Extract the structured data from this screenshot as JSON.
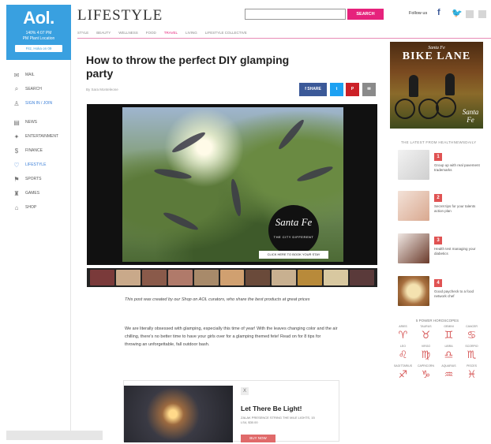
{
  "sidebar": {
    "logo": "Aol.",
    "logo_sub": "140% 4:07 PM\nPM Plant Location",
    "logo_button": "Fitz, Hoka on 09",
    "items": [
      {
        "icon": "✉",
        "label": "MAIL"
      },
      {
        "icon": "⌕",
        "label": "SEARCH"
      },
      {
        "icon": "♙",
        "label": "SIGN IN / JOIN"
      },
      {
        "icon": "▤",
        "label": "NEWS"
      },
      {
        "icon": "✦",
        "label": "ENTERTAINMENT"
      },
      {
        "icon": "$",
        "label": "FINANCE"
      },
      {
        "icon": "♡",
        "label": "LIFESTYLE"
      },
      {
        "icon": "⚑",
        "label": "SPORTS"
      },
      {
        "icon": "♜",
        "label": "GAMES"
      },
      {
        "icon": "⌂",
        "label": "SHOP"
      }
    ]
  },
  "header": {
    "brand": "LIFESTYLE",
    "search_placeholder": "",
    "search_button": "SEARCH",
    "follow_label": "Follow us",
    "social_f": "f",
    "social_t": "🐦",
    "subnav": [
      "STYLE",
      "BEAUTY",
      "WELLNESS",
      "FOOD",
      "TRAVEL",
      "LIVING",
      "LIFESTYLE COLLECTIVE"
    ],
    "active_subnav": "TRAVEL"
  },
  "article": {
    "title": "How to throw the perfect DIY glamping party",
    "byline": "By Sara Monteleone",
    "share_fb": "f SHARE",
    "share_tw": "t",
    "share_pi": "P",
    "share_em": "✉",
    "video_logo_script": "Santa Fe",
    "video_logo_tag": "THE CITY DIFFERENT",
    "video_cta": "CLICK HERE TO BOOK YOUR STAY",
    "caption": "This post was created by our Shop on AOL curators, who share the best products at great prices",
    "body": "We are literally obsessed with glamping, especially this time of year! With the leaves changing color and the air chilling, there's no better time to have your girls over for a glamping themed fete! Read on for 8 tips for throwing an unforgettable, fall outdoor bash."
  },
  "card": {
    "close": "X",
    "title": "Let There Be Light!",
    "subtitle": "ZALAK PRESENCE STRING THE MILE LIGHTS, 15 LS4, $30.00",
    "button": "BUY NOW"
  },
  "ad": {
    "sub": "Santa Fe",
    "title": "BIKE LANE",
    "sign": "Santa Fe"
  },
  "rail": {
    "heading": "THE LATEST FROM HEALTHNEWSDAILY",
    "items": [
      {
        "num": "1",
        "text": "Group up with real pavement trademarks"
      },
      {
        "num": "2",
        "text": "Secret tips for your talents action plan"
      },
      {
        "num": "3",
        "text": "Health test managing your diabetics"
      },
      {
        "num": "4",
        "text": "Good paycheck to a food network chef"
      }
    ]
  },
  "horoscope": {
    "heading": "5 POWER HOROSCOPES",
    "signs": [
      {
        "name": "ARIES",
        "symbol": "♈"
      },
      {
        "name": "TAURUS",
        "symbol": "♉"
      },
      {
        "name": "GEMINI",
        "symbol": "♊"
      },
      {
        "name": "CANCER",
        "symbol": "♋"
      },
      {
        "name": "LEO",
        "symbol": "♌"
      },
      {
        "name": "VIRGO",
        "symbol": "♍"
      },
      {
        "name": "LIBRA",
        "symbol": "♎"
      },
      {
        "name": "SCORPIO",
        "symbol": "♏"
      },
      {
        "name": "SAGITTARIUS",
        "symbol": "♐"
      },
      {
        "name": "CAPRICORN",
        "symbol": "♑"
      },
      {
        "name": "AQUARIUS",
        "symbol": "♒"
      },
      {
        "name": "PISCES",
        "symbol": "♓"
      }
    ]
  },
  "colors": {
    "aol_blue": "#39a0e0",
    "search_pink": "#e6227c",
    "facebook": "#3b5998",
    "twitter": "#1da1f2",
    "pinterest": "#cb2027",
    "rail_accent": "#e05353"
  }
}
